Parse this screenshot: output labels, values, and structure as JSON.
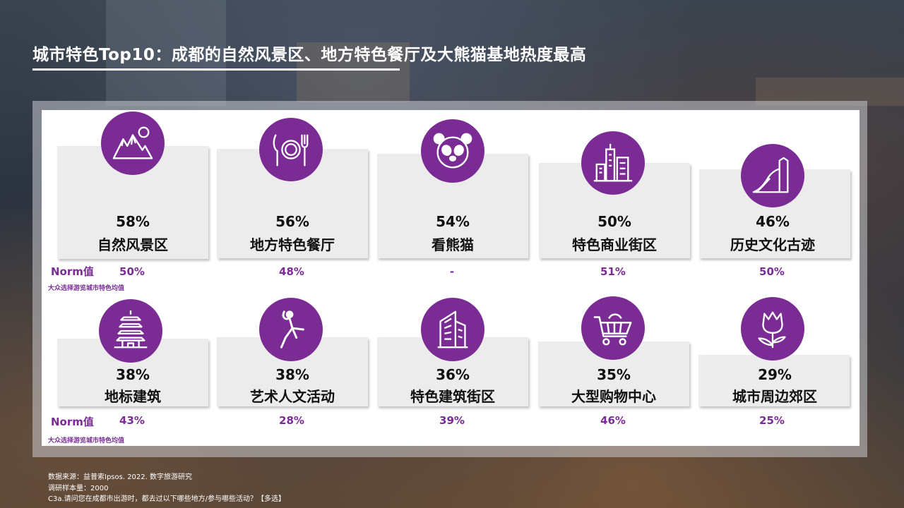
{
  "title": "城市特色Top10：成都的自然风景区、地方特色餐厅及大熊猫基地热度最高",
  "norm": {
    "label": "Norm值",
    "note": "大众选择游览城市特色均值"
  },
  "row1": [
    {
      "pct": "58%",
      "label": "自然风景区",
      "norm": "50%",
      "icon": "mountain-sun-icon"
    },
    {
      "pct": "56%",
      "label": "地方特色餐厅",
      "norm": "48%",
      "icon": "plate-cutlery-icon"
    },
    {
      "pct": "54%",
      "label": "看熊猫",
      "norm": "-",
      "icon": "panda-icon"
    },
    {
      "pct": "50%",
      "label": "特色商业街区",
      "norm": "51%",
      "icon": "city-buildings-icon"
    },
    {
      "pct": "46%",
      "label": "历史文化古迹",
      "norm": "50%",
      "icon": "great-wall-icon"
    }
  ],
  "row2": [
    {
      "pct": "38%",
      "label": "地标建筑",
      "norm": "43%",
      "icon": "pagoda-icon"
    },
    {
      "pct": "38%",
      "label": "艺术人文活动",
      "norm": "28%",
      "icon": "dancer-icon"
    },
    {
      "pct": "36%",
      "label": "特色建筑街区",
      "norm": "39%",
      "icon": "skyscraper-icon"
    },
    {
      "pct": "35%",
      "label": "大型购物中心",
      "norm": "46%",
      "icon": "shopping-cart-icon"
    },
    {
      "pct": "29%",
      "label": "城市周边郊区",
      "norm": "25%",
      "icon": "tulip-icon"
    }
  ],
  "source": {
    "line1": "数据来源：益普索Ipsos. 2022. 数字旅游研究",
    "line2": "调研样本量：2000",
    "line3": "C3a.请问您在成都市出游时，都去过以下哪些地方/参与哪些活动？【多选】"
  },
  "colors": {
    "accent": "#7a2c94",
    "card": "#ececec"
  }
}
